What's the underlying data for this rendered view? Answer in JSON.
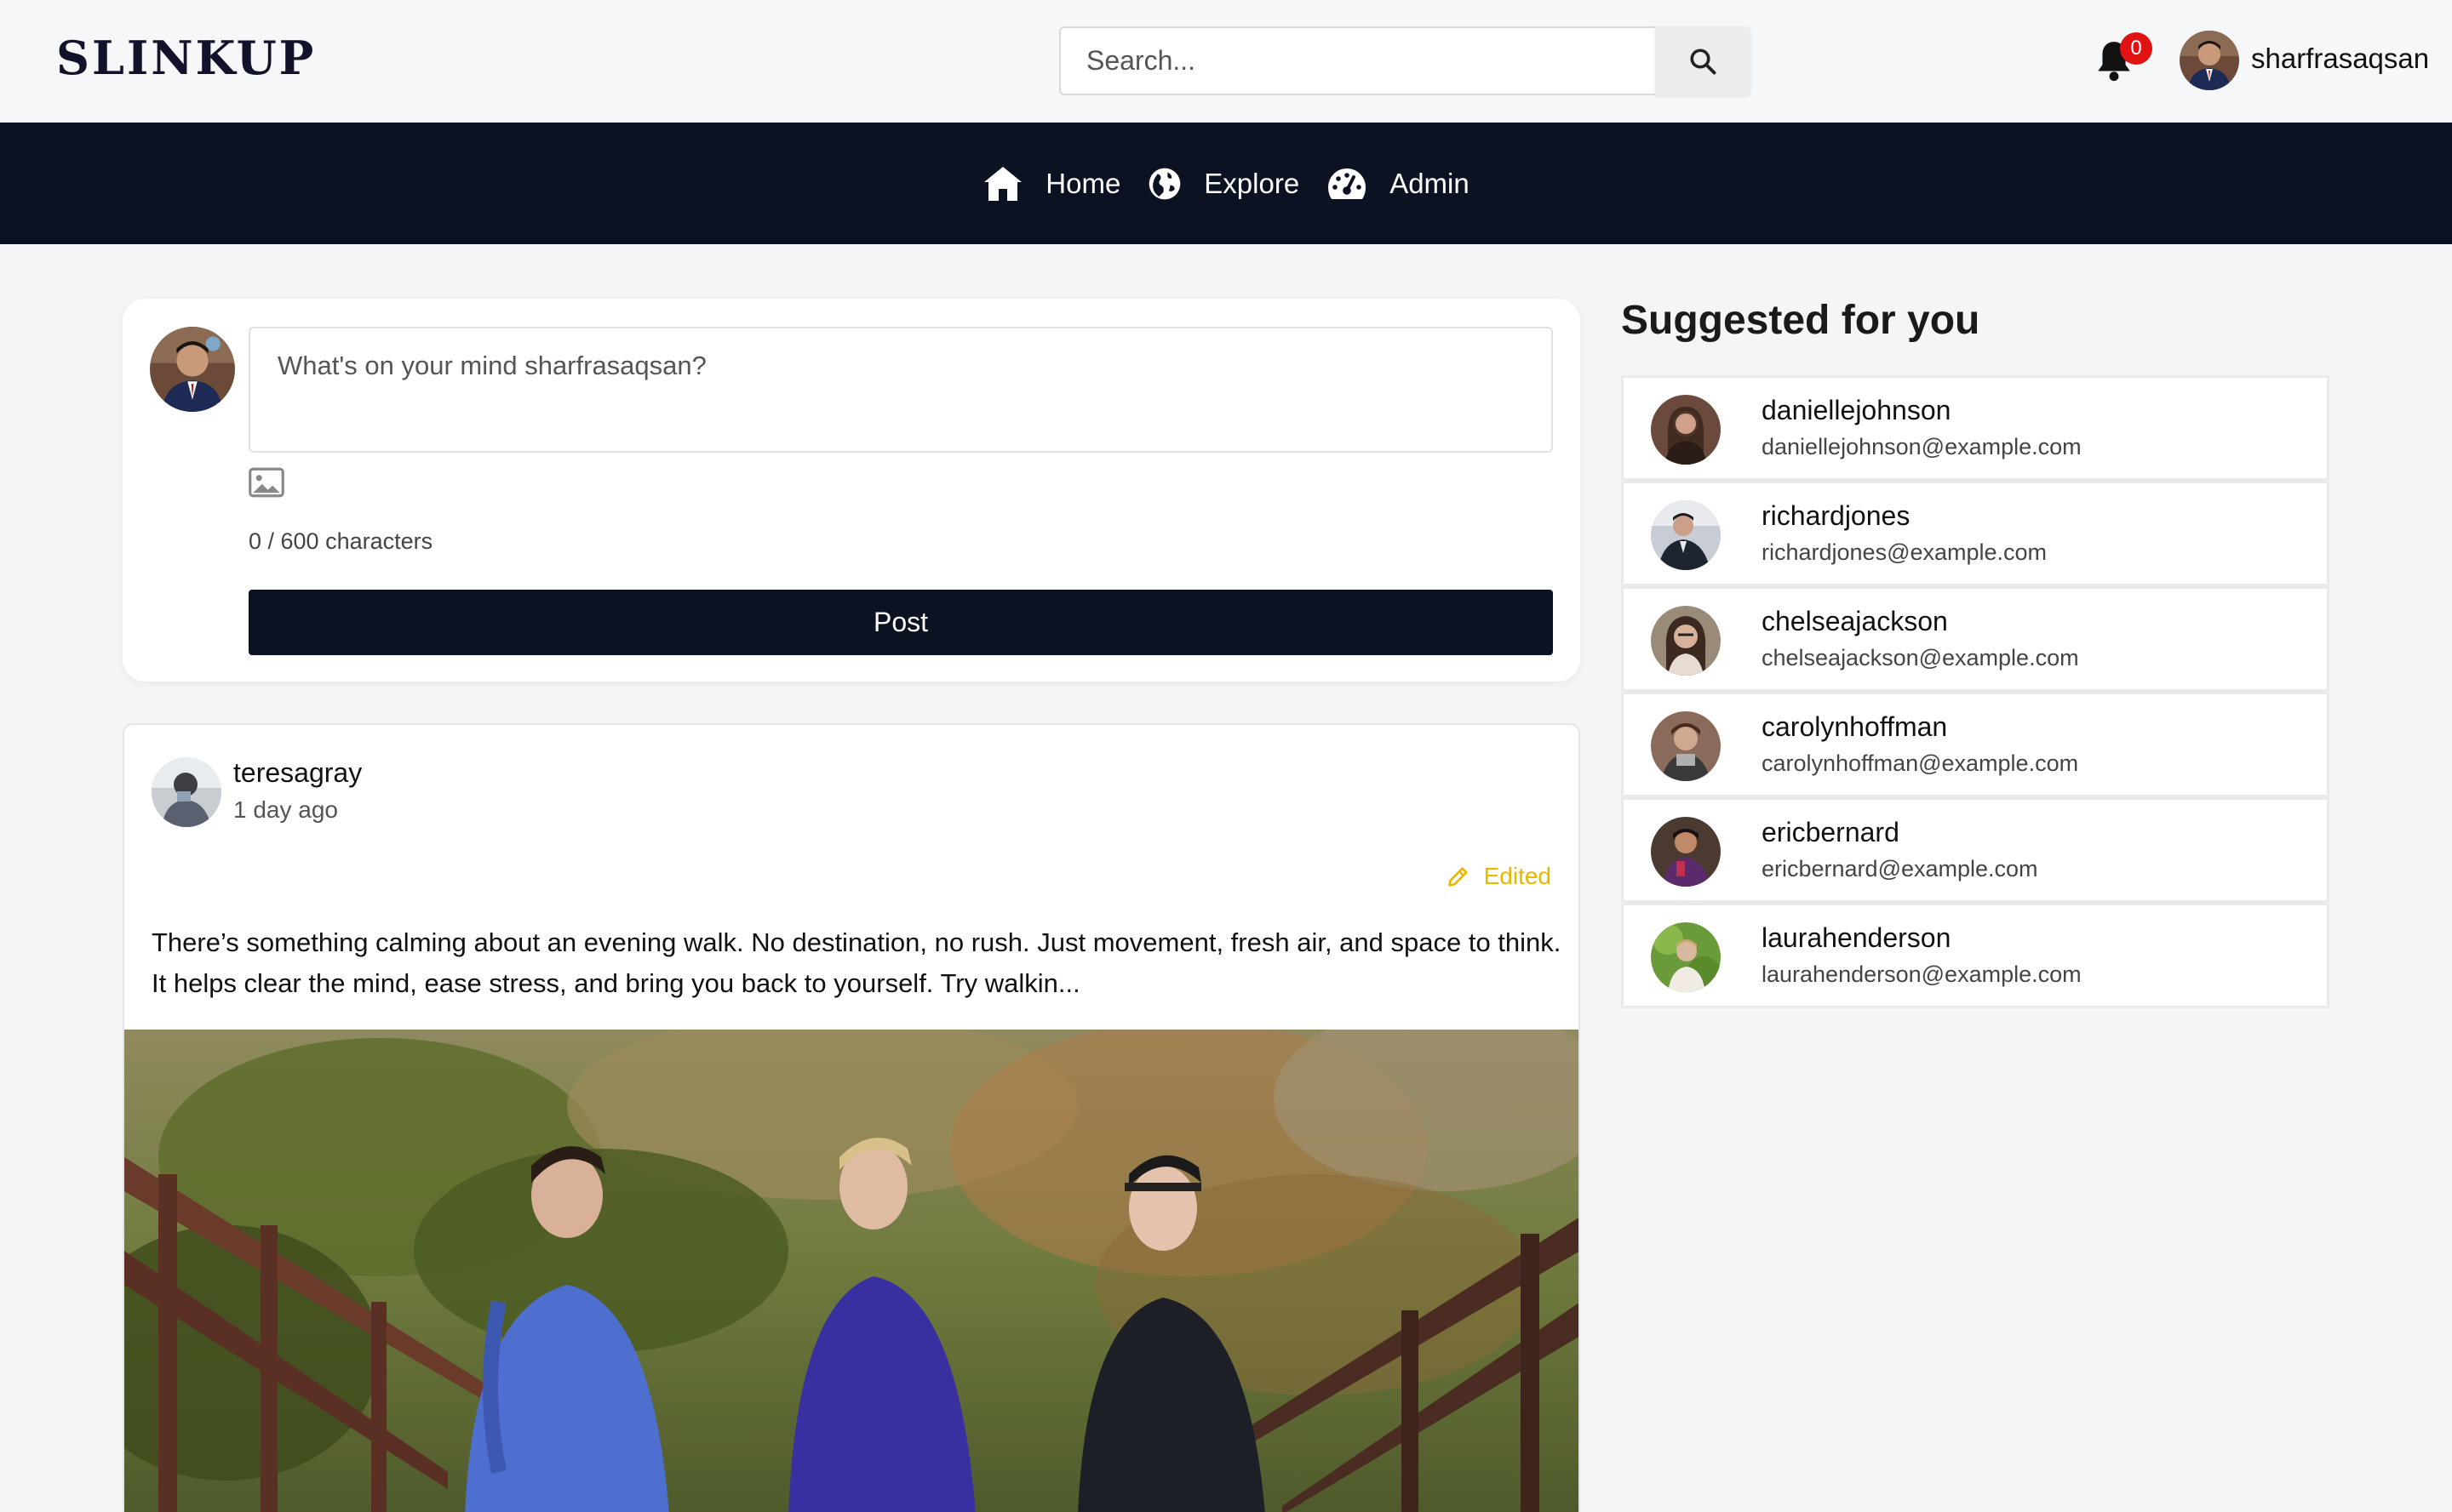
{
  "header": {
    "logo": "SLINKUP",
    "search_placeholder": "Search...",
    "notification_count": "0",
    "username": "sharfrasaqsan"
  },
  "nav": {
    "items": [
      {
        "label": "Home",
        "icon": "home-icon"
      },
      {
        "label": "Explore",
        "icon": "globe-icon"
      },
      {
        "label": "Admin",
        "icon": "dashboard-icon"
      }
    ]
  },
  "composer": {
    "placeholder": "What's on your mind sharfrasaqsan?",
    "char_count": "0 / 600 characters",
    "post_label": "Post"
  },
  "post": {
    "username": "teresagray",
    "time": "1 day ago",
    "edited_label": "Edited",
    "body": "There’s something calming about an evening walk. No destination, no rush. Just movement, fresh air, and space to think. It helps clear the mind, ease stress, and bring you back to yourself. Try walkin..."
  },
  "suggestions": {
    "title": "Suggested for you",
    "items": [
      {
        "name": "daniellejohnson",
        "email": "daniellejohnson@example.com"
      },
      {
        "name": "richardjones",
        "email": "richardjones@example.com"
      },
      {
        "name": "chelseajackson",
        "email": "chelseajackson@example.com"
      },
      {
        "name": "carolynhoffman",
        "email": "carolynhoffman@example.com"
      },
      {
        "name": "ericbernard",
        "email": "ericbernard@example.com"
      },
      {
        "name": "laurahenderson",
        "email": "laurahenderson@example.com"
      }
    ]
  },
  "colors": {
    "nav_bg": "#0d1222",
    "badge": "#e11212",
    "edited": "#e6b800"
  }
}
